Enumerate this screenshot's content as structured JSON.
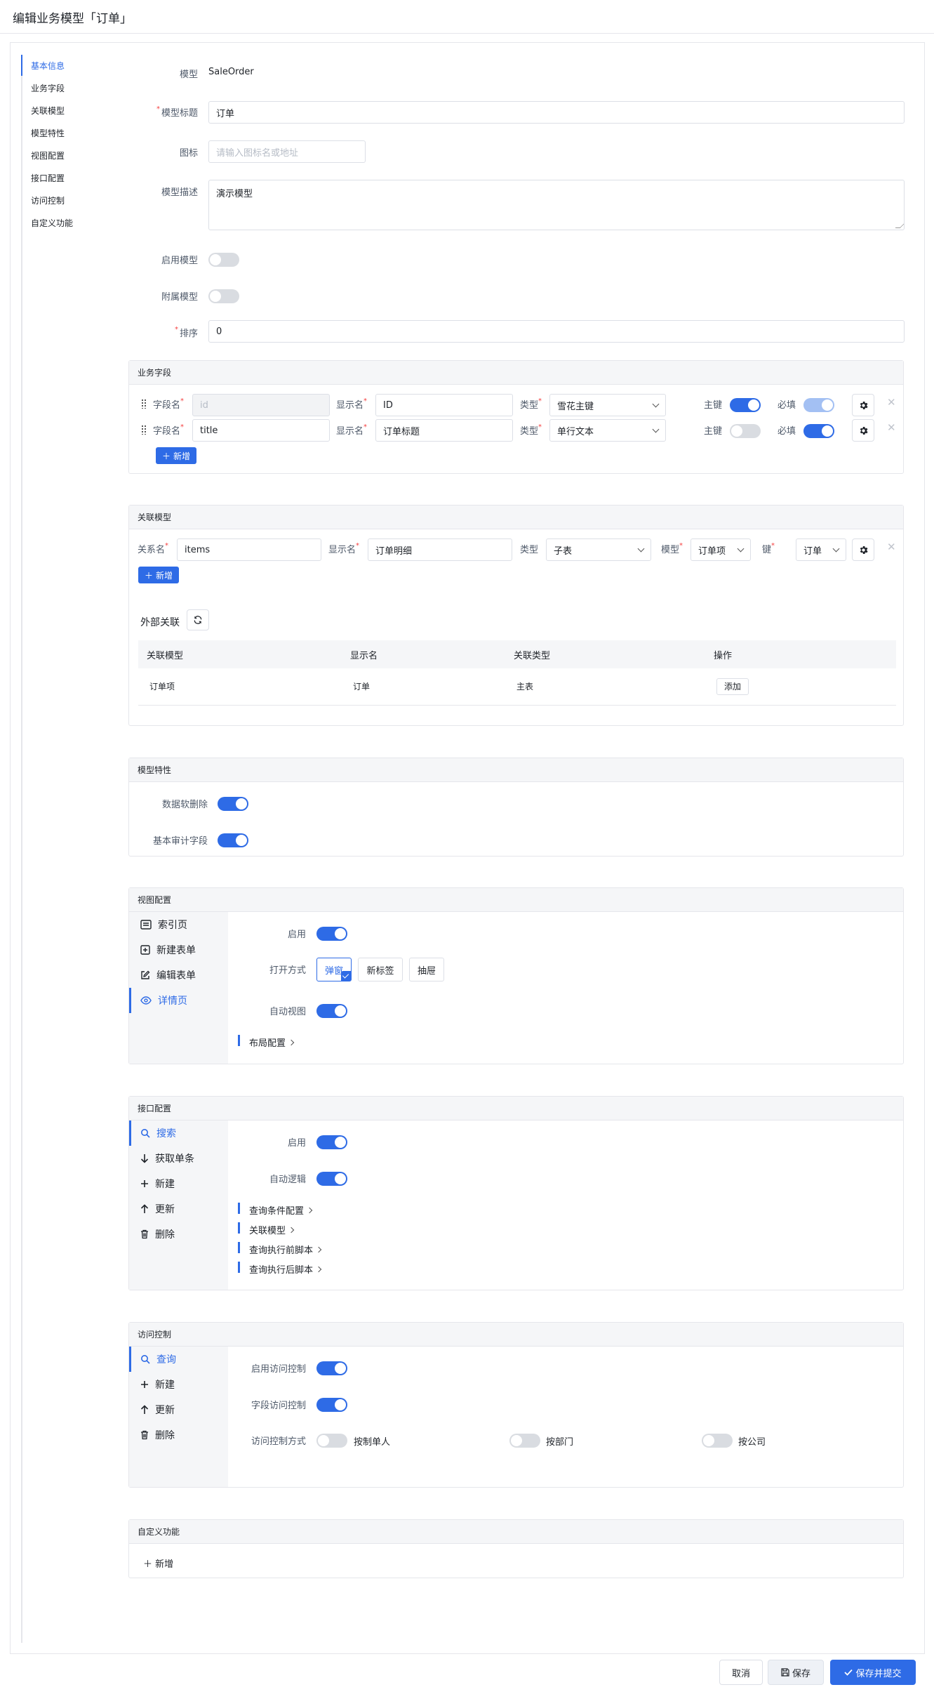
{
  "page": {
    "title": "编辑业务模型「订单」"
  },
  "nav": [
    "基本信息",
    "业务字段",
    "关联模型",
    "模型特性",
    "视图配置",
    "接口配置",
    "访问控制",
    "自定义功能"
  ],
  "basic": {
    "model_label": "模型",
    "model_value": "SaleOrder",
    "title_label": "模型标题",
    "title_value": "订单",
    "icon_label": "图标",
    "icon_placeholder": "请输入图标名或地址",
    "desc_label": "模型描述",
    "desc_value": "演示模型",
    "enable_label": "启用模型",
    "enable_on": false,
    "attached_label": "附属模型",
    "attached_on": false,
    "sort_label": "排序",
    "sort_value": "0"
  },
  "fields": {
    "header": "业务字段",
    "field_name_label": "字段名",
    "display_label": "显示名",
    "type_label": "类型",
    "primary_label": "主键",
    "required_label": "必填",
    "rows": [
      {
        "name": "id",
        "display": "ID",
        "type": "雪花主键",
        "primary": true,
        "required": true
      },
      {
        "name": "title",
        "display": "订单标题",
        "type": "单行文本",
        "primary": false,
        "required": true
      }
    ],
    "add_label": "新增"
  },
  "relations": {
    "header": "关联模型",
    "rel_name_label": "关系名",
    "display_label": "显示名",
    "type_label": "类型",
    "model_label": "模型",
    "key_label": "键",
    "row": {
      "name": "items",
      "display": "订单明细",
      "type": "子表",
      "model": "订单项",
      "key": "订单"
    },
    "add_label": "新增",
    "external_label": "外部关联",
    "table": {
      "columns": [
        "关联模型",
        "显示名",
        "关联类型",
        "操作"
      ],
      "rows": [
        {
          "model": "订单项",
          "display": "订单",
          "type": "主表",
          "action": "添加"
        }
      ]
    }
  },
  "features": {
    "header": "模型特性",
    "soft_delete_label": "数据软删除",
    "soft_delete_on": true,
    "audit_label": "基本审计字段",
    "audit_on": true
  },
  "views": {
    "header": "视图配置",
    "items": [
      "索引页",
      "新建表单",
      "编辑表单",
      "详情页"
    ],
    "active": "详情页",
    "enable_label": "启用",
    "enable_on": true,
    "open_label": "打开方式",
    "open_options": [
      "弹窗",
      "新标签",
      "抽屉"
    ],
    "open_selected": "弹窗",
    "auto_label": "自动视图",
    "auto_on": true,
    "layout_link": "布局配置"
  },
  "api": {
    "header": "接口配置",
    "items": [
      "搜索",
      "获取单条",
      "新建",
      "更新",
      "删除"
    ],
    "active": "搜索",
    "enable_label": "启用",
    "enable_on": true,
    "auto_label": "自动逻辑",
    "auto_on": true,
    "links": [
      "查询条件配置",
      "关联模型",
      "查询执行前脚本",
      "查询执行后脚本"
    ]
  },
  "access": {
    "header": "访问控制",
    "items": [
      "查询",
      "新建",
      "更新",
      "删除"
    ],
    "active": "查询",
    "enable_label": "启用访问控制",
    "enable_on": true,
    "field_label": "字段访问控制",
    "field_on": true,
    "mode_label": "访问控制方式",
    "modes": [
      {
        "label": "按制单人",
        "on": false
      },
      {
        "label": "按部门",
        "on": false
      },
      {
        "label": "按公司",
        "on": false
      }
    ]
  },
  "custom": {
    "header": "自定义功能",
    "add_label": "新增"
  },
  "footer": {
    "cancel": "取消",
    "save": "保存",
    "submit": "保存并提交"
  },
  "colors": {
    "primary": "#2e6be6",
    "border": "#e5e6eb",
    "header_bg": "#f5f6f8",
    "required": "#f53f3f"
  }
}
